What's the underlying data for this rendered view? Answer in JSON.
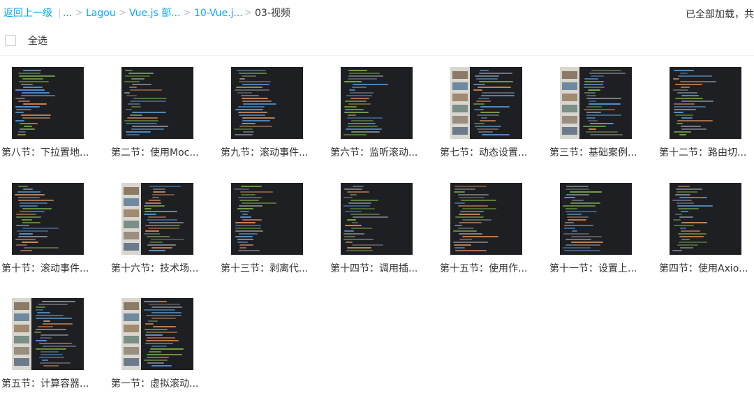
{
  "breadcrumb": {
    "back": "返回上一级",
    "pipe": "|",
    "ellipsis": "...",
    "separator": ">",
    "items": [
      "Lagou",
      "Vue.js 部...",
      "10-Vue.j...",
      "03-视频"
    ]
  },
  "status_text": "已全部加载，共",
  "select_all_label": "全选",
  "files": [
    {
      "name": "第八节：下拉置地...",
      "icon": "video-thumbnail-code-dark"
    },
    {
      "name": "第二节：使用Moc...",
      "icon": "video-thumbnail-code-dark"
    },
    {
      "name": "第九节：滚动事件...",
      "icon": "video-thumbnail-code-dark"
    },
    {
      "name": "第六节：监听滚动...",
      "icon": "video-thumbnail-code-dark"
    },
    {
      "name": "第七节：动态设置...",
      "icon": "video-thumbnail-split-light"
    },
    {
      "name": "第三节：基础案例...",
      "icon": "video-thumbnail-split-light"
    },
    {
      "name": "第十二节：路由切...",
      "icon": "video-thumbnail-code-dark"
    },
    {
      "name": "第十节：滚动事件...",
      "icon": "video-thumbnail-code-dark"
    },
    {
      "name": "第十六节：技术场...",
      "icon": "video-thumbnail-split-light"
    },
    {
      "name": "第十三节：剥离代...",
      "icon": "video-thumbnail-code-dark"
    },
    {
      "name": "第十四节：调用插...",
      "icon": "video-thumbnail-code-dark"
    },
    {
      "name": "第十五节：使用作...",
      "icon": "video-thumbnail-code-dark"
    },
    {
      "name": "第十一节：设置上...",
      "icon": "video-thumbnail-code-dark"
    },
    {
      "name": "第四节：使用Axio...",
      "icon": "video-thumbnail-code-dark"
    },
    {
      "name": "第五节：计算容器...",
      "icon": "video-thumbnail-split-light"
    },
    {
      "name": "第一节：虚拟滚动...",
      "icon": "video-thumbnail-split-light"
    }
  ],
  "colors": {
    "link": "#06a7ff",
    "thumb_bg": "#1e1f23",
    "code_green": "#7fb347",
    "code_orange": "#e0925a",
    "code_blue": "#5aa0e0",
    "code_grey": "#8a8f98"
  }
}
